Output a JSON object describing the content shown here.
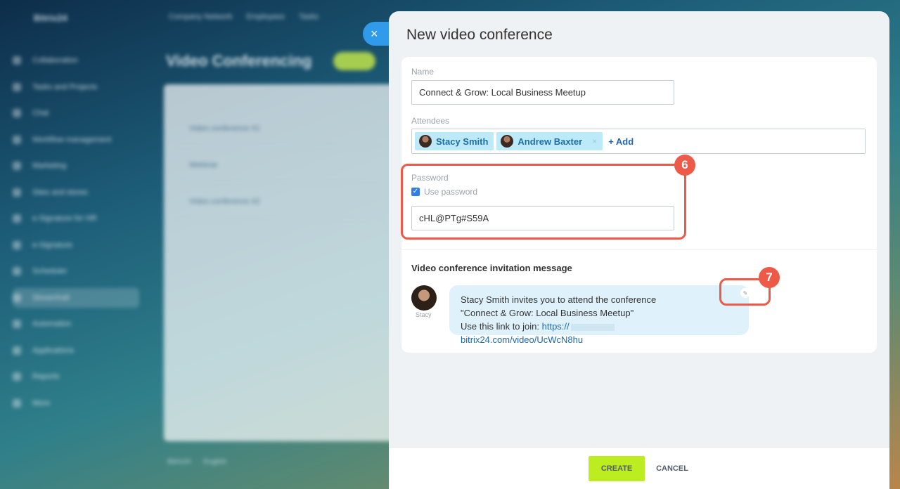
{
  "background": {
    "logo": "Bitrix24",
    "top_nav": [
      "Company Network",
      "Employees",
      "Tasks"
    ],
    "page_title": "Video Conferencing",
    "menu": [
      "Collaboration",
      "Tasks and Projects",
      "Chat",
      "Workflow management",
      "Marketing",
      "Sites and stores",
      "e-Signature for HR",
      "e-Signature",
      "Scheduler",
      "Streamhall",
      "Automation",
      "Applications",
      "Reports",
      "More"
    ],
    "active_menu_index": 9,
    "list_rows": [
      "Video conference #1",
      "Webinar",
      "Video conference #2"
    ],
    "footer_links": [
      "Bitrix24",
      "English"
    ]
  },
  "slider": {
    "close_icon": "×",
    "title": "New video conference"
  },
  "form": {
    "name_label": "Name",
    "name_value": "Connect & Grow: Local Business Meetup",
    "attendees_label": "Attendees",
    "attendees": [
      {
        "name": "Stacy Smith",
        "removable": false
      },
      {
        "name": "Andrew Baxter",
        "removable": true,
        "remove_icon": "×"
      }
    ],
    "add_label": "+ Add",
    "password_label": "Password",
    "use_password_label": "Use password",
    "use_password_checked": true,
    "password_value": "cHL@PTg#S59A"
  },
  "invitation": {
    "section_title": "Video conference invitation message",
    "avatar_name": "Stacy",
    "line1": "Stacy Smith invites you to attend the conference",
    "line2": "\"Connect & Grow: Local Business Meetup\"",
    "line3_prefix": "Use this link to join:",
    "link_start": "https://",
    "link_end": "bitrix24.com/video/UcWcN8hu",
    "edit_icon": "✎"
  },
  "annotations": [
    {
      "number": "6",
      "color": "#ee5a48"
    },
    {
      "number": "7",
      "color": "#ee5a48"
    }
  ],
  "footer": {
    "create_label": "CREATE",
    "cancel_label": "CANCEL"
  },
  "colors": {
    "accent_blue": "#2f9bea",
    "create_green": "#bbed21",
    "highlight_red": "#ee5a48",
    "link_blue": "#2067b0"
  }
}
